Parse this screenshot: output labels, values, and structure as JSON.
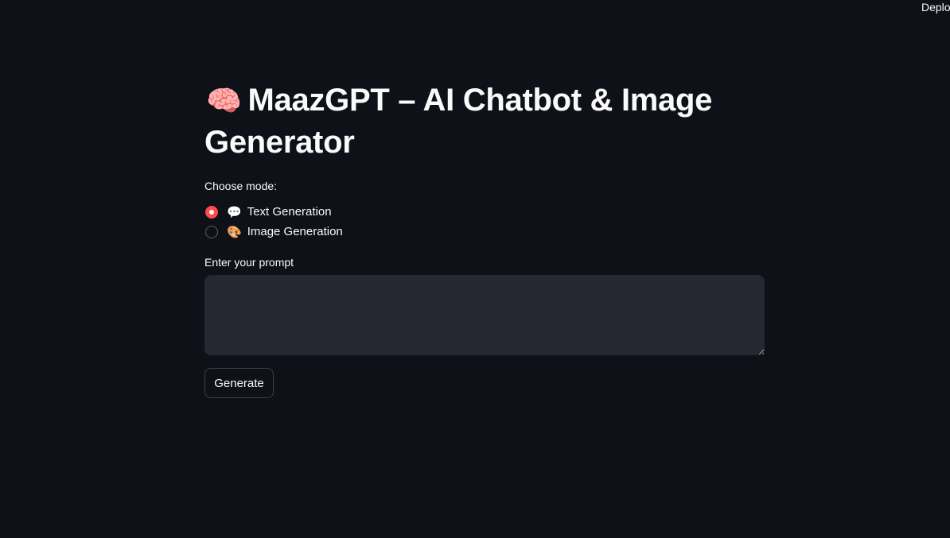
{
  "header": {
    "deploy_label": "Deploy"
  },
  "main": {
    "title_emoji": "🧠",
    "title": "MaazGPT – AI Chatbot & Image Generator",
    "mode": {
      "label": "Choose mode:",
      "options": [
        {
          "icon": "💬",
          "icon_name": "speech-bubble-icon",
          "label": "Text Generation",
          "selected": true
        },
        {
          "icon": "🎨",
          "icon_name": "palette-icon",
          "label": "Image Generation",
          "selected": false
        }
      ]
    },
    "prompt": {
      "label": "Enter your prompt",
      "value": "",
      "placeholder": ""
    },
    "generate_button": "Generate"
  },
  "colors": {
    "background": "#0e1117",
    "input_bg": "#262730",
    "accent": "#ff4b4b",
    "text": "#fafafa"
  }
}
